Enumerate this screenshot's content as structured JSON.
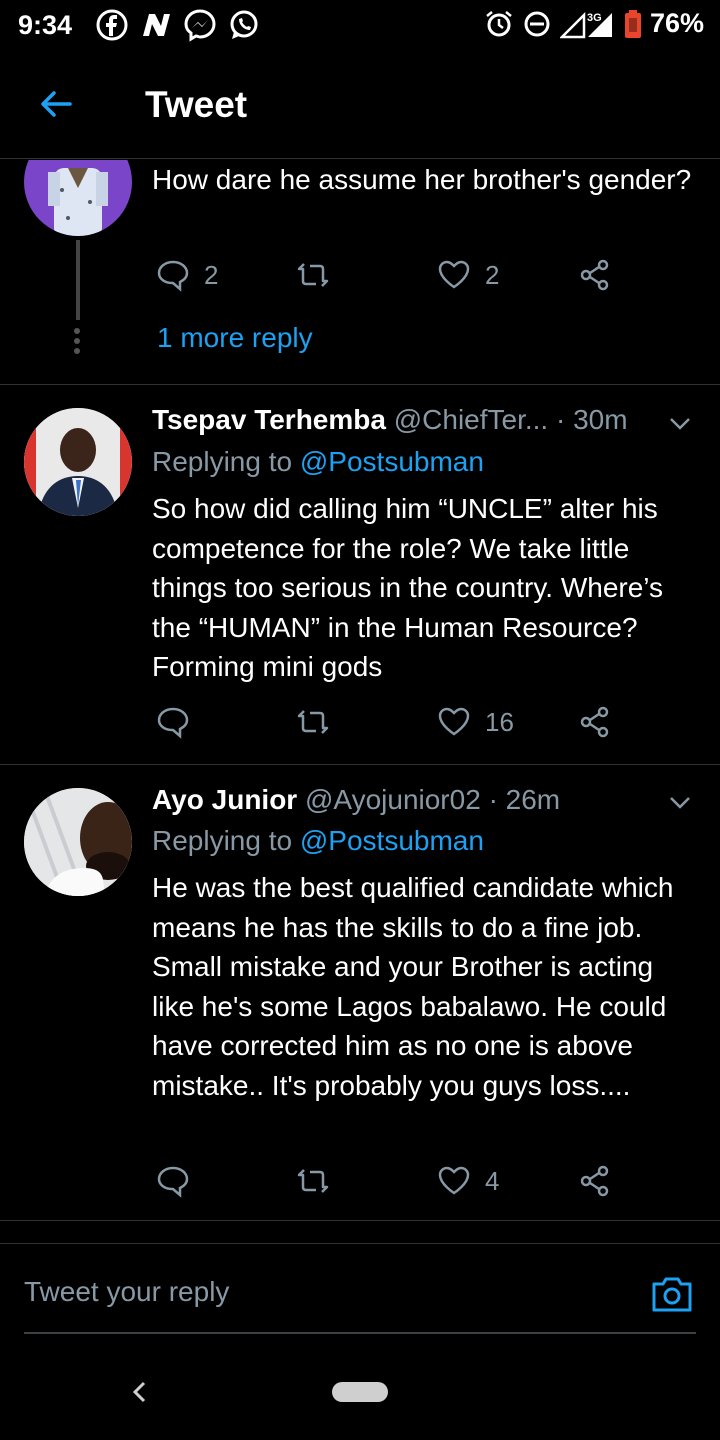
{
  "status_bar": {
    "time": "9:34",
    "network": "3G",
    "battery": "76%",
    "left_icons": [
      "facebook-icon",
      "n-icon",
      "messenger-icon",
      "whatsapp-icon"
    ],
    "right_icons": [
      "alarm-icon",
      "dnd-icon",
      "signal-icon",
      "battery-icon"
    ]
  },
  "header": {
    "title": "Tweet"
  },
  "tweets": [
    {
      "text": "How dare he assume her brother's gender?",
      "reply_count": "2",
      "like_count": "2",
      "more_replies": "1 more reply"
    },
    {
      "name": "Tsepav Terhemba",
      "handle": "@ChiefTer...",
      "time": "· 30m",
      "replying_prefix": "Replying to",
      "replying_to": "@Postsubman",
      "text": "So how did calling him “UNCLE” alter his competence for the role? We take little things too serious in the country. Where’s the “HUMAN” in the Human Resource? Forming mini gods",
      "like_count": "16"
    },
    {
      "name": "Ayo Junior",
      "handle": "@Ayojunior02",
      "time": "· 26m",
      "replying_prefix": "Replying to",
      "replying_to": "@Postsubman",
      "text": "He was the best qualified candidate which means he has the skills to do a fine job. Small mistake and your Brother is acting like he's some Lagos babalawo. He could have corrected him as no one is above mistake..  It's probably you guys loss....",
      "like_count": "4"
    }
  ],
  "reply_box": {
    "placeholder": "Tweet your reply"
  },
  "colors": {
    "accent": "#1da1f2",
    "muted": "#8899a6",
    "background": "#000000",
    "divider": "#2f3336"
  }
}
